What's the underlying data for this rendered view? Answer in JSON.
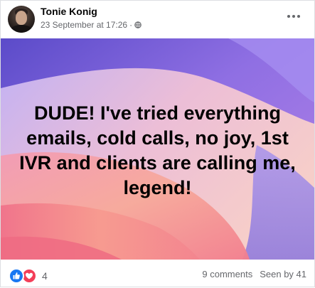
{
  "post": {
    "author": "Tonie Konig",
    "date": "23 September at 17:26",
    "separator": "·",
    "privacy_icon": "globe-icon",
    "more_icon": "more-options-icon",
    "text": "DUDE! I've tried everything\nemails, cold calls, no joy, 1st\nIVR and clients are calling me,\nlegend!",
    "background_colors": [
      "#6e5bd6",
      "#9b6fe0",
      "#e88bbd",
      "#f6a89d",
      "#f47a86"
    ]
  },
  "footer": {
    "reaction_icons": [
      "like-icon",
      "love-icon"
    ],
    "reaction_count": "4",
    "comments": "9 comments",
    "seen_by": "Seen by 41"
  }
}
